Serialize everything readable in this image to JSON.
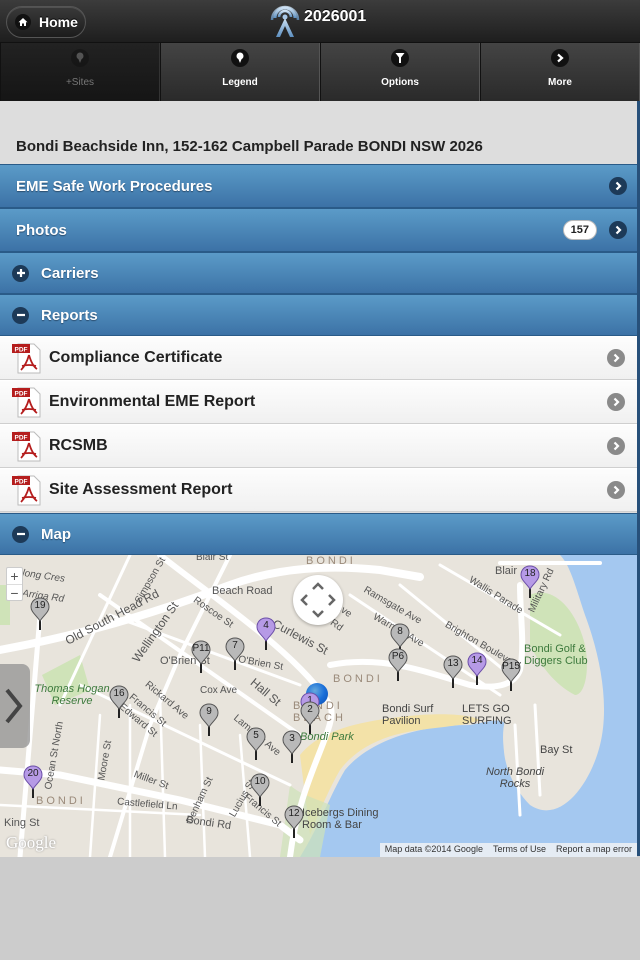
{
  "header": {
    "home_label": "Home",
    "title": "2026001",
    "icons": {
      "home": "home-icon",
      "logo": "antenna-tower-icon"
    }
  },
  "navbar": {
    "items": [
      {
        "label": "+Sites",
        "icon": "map-pin-icon",
        "disabled": true
      },
      {
        "label": "Legend",
        "icon": "map-pin-icon",
        "disabled": false
      },
      {
        "label": "Options",
        "icon": "filter-icon",
        "disabled": false
      },
      {
        "label": "More",
        "icon": "chevron-right-icon",
        "disabled": false
      }
    ]
  },
  "site": {
    "address": "Bondi Beachside Inn, 152-162 Campbell Parade BONDI NSW 2026"
  },
  "sections": {
    "eme": {
      "label": "EME Safe Work Procedures"
    },
    "photos": {
      "label": "Photos",
      "count": "157"
    },
    "carriers": {
      "label": "Carriers",
      "state": "collapsed"
    },
    "reports": {
      "label": "Reports",
      "state": "expanded",
      "items": [
        {
          "label": "Compliance Certificate",
          "type": "PDF"
        },
        {
          "label": "Environmental EME Report",
          "type": "PDF"
        },
        {
          "label": "RCSMB",
          "type": "PDF"
        },
        {
          "label": "Site Assessment Report",
          "type": "PDF"
        }
      ]
    },
    "map": {
      "label": "Map",
      "state": "expanded"
    }
  },
  "map": {
    "zoom_in": "+",
    "zoom_out": "−",
    "markers": [
      {
        "label": "1",
        "color": "purple"
      },
      {
        "label": "2",
        "color": "grey"
      },
      {
        "label": "3",
        "color": "grey"
      },
      {
        "label": "4",
        "color": "purple"
      },
      {
        "label": "5",
        "color": "grey"
      },
      {
        "label": "7",
        "color": "grey"
      },
      {
        "label": "8",
        "color": "grey"
      },
      {
        "label": "P6",
        "color": "grey"
      },
      {
        "label": "9",
        "color": "grey"
      },
      {
        "label": "10",
        "color": "grey"
      },
      {
        "label": "P11",
        "color": "grey"
      },
      {
        "label": "12",
        "color": "grey"
      },
      {
        "label": "13",
        "color": "grey"
      },
      {
        "label": "14",
        "color": "purple"
      },
      {
        "label": "P15",
        "color": "grey"
      },
      {
        "label": "16",
        "color": "grey"
      },
      {
        "label": "18",
        "color": "purple"
      },
      {
        "label": "19",
        "color": "grey"
      },
      {
        "label": "20",
        "color": "purple"
      }
    ],
    "labels": {
      "blair_st": "Blair St",
      "blair": "Blair",
      "beach_road": "Beach Road",
      "pelong_cres": "Pelong Cres",
      "arriga_rd": "Arriga Rd",
      "old_south_head_rd": "Old South Head Rd",
      "simpson_st": "Simpson St",
      "wellington_st": "Wellington St",
      "roscoe_st": "Roscoe St",
      "hall_st": "Hall St",
      "obrien_st_1": "O'Brien St",
      "obrien_st_2": "O'Brien St",
      "curlewis_st": "Curlewis St",
      "glenayr_ave": "Ave",
      "gould_rd": "Rd",
      "ramsgate_ave": "Ramsgate Ave",
      "warners_ave": "Warners Ave",
      "wallis_parade": "Wallis Parade",
      "military_rd": "Military Rd",
      "brighton_blvd": "Brighton Boulevard",
      "golf_club": "Bondi Golf & Diggers Club",
      "thomas_hogan": "Thomas Hogan Reserve",
      "cox_ave": "Cox Ave",
      "rickard_ave": "Rickard Ave",
      "edward_st": "Edward St",
      "francis_st_1": "Francis St",
      "francis_st_2": "Francis St",
      "lamrock_ave": "Lamrock Ave",
      "lucius_st": "Lucius St",
      "ocean_st_north": "Ocean St North",
      "moore_st": "Moore St",
      "miller_st": "Miller St",
      "denham_st": "Denham St",
      "castlefield_ln": "Castlefield Ln",
      "bondi_rd_1": "Bondi Rd",
      "king_st": "King St",
      "bondi_1": "BONDI",
      "bondi_2": "BONDI",
      "bondi_3": "BONDI",
      "bondi_beach": "BONDI BEACH",
      "bondi_park": "Bondi Park",
      "surf_pavilion": "Bondi Surf Pavilion",
      "lets_go_surfing": "LETS GO SURFING",
      "bay_st": "Bay St",
      "north_bondi_rocks": "North Bondi Rocks",
      "icebergs": "Icebergs Dining Room & Bar"
    },
    "attribution": {
      "data": "Map data ©2014 Google",
      "terms": "Terms of Use",
      "report": "Report a map error"
    },
    "logo": "Google"
  }
}
